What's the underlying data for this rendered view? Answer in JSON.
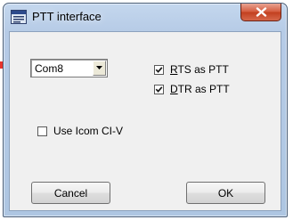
{
  "window": {
    "title": "PTT interface",
    "close_symbol": "x"
  },
  "icons": {
    "app": "app-window-icon",
    "close": "close-icon",
    "dropdown": "chevron-down-icon",
    "check": "checkmark-icon",
    "pointer": "red-arrow-pointer-icon"
  },
  "port": {
    "selected": "Com8"
  },
  "options": {
    "rts": {
      "accel": "R",
      "rest": "TS as PTT",
      "checked": true
    },
    "dtr": {
      "accel": "D",
      "rest": "TR as PTT",
      "checked": true
    },
    "icom": {
      "label": "Use Icom CI-V",
      "checked": false
    }
  },
  "buttons": {
    "cancel": "Cancel",
    "ok": "OK"
  },
  "colors": {
    "pointer": "#e8342c",
    "close_button": "#c8452a",
    "title_bar": "#b9cfe8"
  }
}
